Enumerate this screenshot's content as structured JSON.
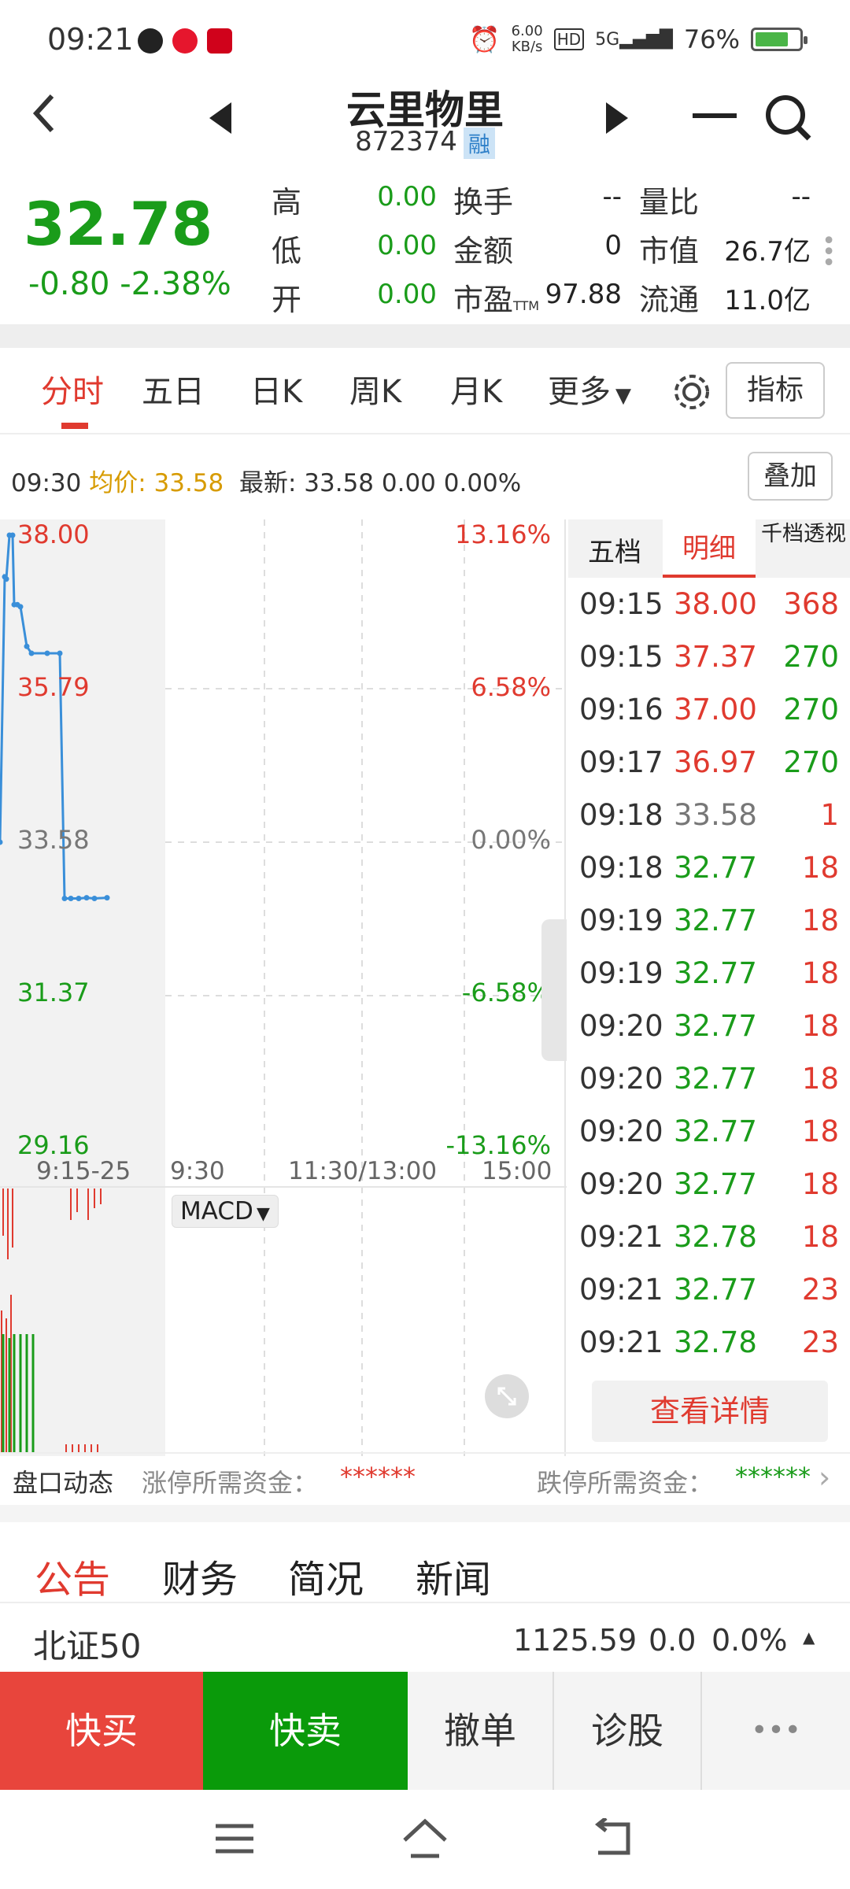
{
  "status_bar": {
    "time": "09:21",
    "net_speed_top": "6.00",
    "net_speed_bottom": "KB/s",
    "network": "5G",
    "battery": "76%",
    "battery_level": 0.76
  },
  "header": {
    "title": "云里物里",
    "code": "872374",
    "badge": "融"
  },
  "quote": {
    "price": "32.78",
    "change": "-0.80  -2.38%",
    "high_label": "高",
    "high_value": "0.00",
    "low_label": "低",
    "low_value": "0.00",
    "open_label": "开",
    "open_value": "0.00",
    "turnover_label": "换手",
    "turnover_value": "--",
    "amount_label": "金额",
    "amount_value": "0",
    "pe_label": "市盈",
    "pe_sub": "TTM",
    "pe_value": "97.88",
    "vol_ratio_label": "量比",
    "vol_ratio_value": "--",
    "mktcap_label": "市值",
    "mktcap_value": "26.7亿",
    "float_label": "流通",
    "float_value": "11.0亿"
  },
  "tabs": {
    "items": [
      "分时",
      "五日",
      "日K",
      "周K",
      "月K",
      "更多"
    ],
    "active": "分时",
    "indicator_button": "指标"
  },
  "info_line": {
    "time": "09:30",
    "avg_label": "均价:",
    "avg_value": "33.58",
    "latest": "最新: 33.58 0.00 0.00%",
    "overlay_button": "叠加"
  },
  "chart_data": {
    "type": "line",
    "y_left_ticks": [
      "38.00",
      "35.79",
      "33.58",
      "31.37",
      "29.16"
    ],
    "y_right_ticks": [
      "13.16%",
      "6.58%",
      "0.00%",
      "-6.58%",
      "-13.16%"
    ],
    "x_ticks": [
      "9:15-25",
      "9:30",
      "11:30/13:00",
      "15:00"
    ],
    "ylim": [
      29.16,
      38.0
    ],
    "series": [
      {
        "values": [
          33.58,
          37.4,
          37.37,
          38.0,
          38.0,
          37.0,
          37.0,
          36.97,
          36.4,
          36.3,
          36.3,
          36.3,
          32.77,
          32.77,
          32.77,
          32.78,
          32.77,
          32.78
        ]
      }
    ],
    "indicator_dropdown": "MACD"
  },
  "detail_panel": {
    "tabs": [
      "五档",
      "明细",
      "千档透视"
    ],
    "active_tab": "明细",
    "trades": [
      {
        "time": "09:15",
        "price": "38.00",
        "vol": "368",
        "price_color": "red",
        "vol_color": "red"
      },
      {
        "time": "09:15",
        "price": "37.37",
        "vol": "270",
        "price_color": "red",
        "vol_color": "green"
      },
      {
        "time": "09:16",
        "price": "37.00",
        "vol": "270",
        "price_color": "red",
        "vol_color": "green"
      },
      {
        "time": "09:17",
        "price": "36.97",
        "vol": "270",
        "price_color": "red",
        "vol_color": "green"
      },
      {
        "time": "09:18",
        "price": "33.58",
        "vol": "1",
        "price_color": "gray",
        "vol_color": "red"
      },
      {
        "time": "09:18",
        "price": "32.77",
        "vol": "18",
        "price_color": "green",
        "vol_color": "red"
      },
      {
        "time": "09:19",
        "price": "32.77",
        "vol": "18",
        "price_color": "green",
        "vol_color": "red"
      },
      {
        "time": "09:19",
        "price": "32.77",
        "vol": "18",
        "price_color": "green",
        "vol_color": "red"
      },
      {
        "time": "09:20",
        "price": "32.77",
        "vol": "18",
        "price_color": "green",
        "vol_color": "red"
      },
      {
        "time": "09:20",
        "price": "32.77",
        "vol": "18",
        "price_color": "green",
        "vol_color": "red"
      },
      {
        "time": "09:20",
        "price": "32.77",
        "vol": "18",
        "price_color": "green",
        "vol_color": "red"
      },
      {
        "time": "09:20",
        "price": "32.77",
        "vol": "18",
        "price_color": "green",
        "vol_color": "red"
      },
      {
        "time": "09:21",
        "price": "32.78",
        "vol": "18",
        "price_color": "green",
        "vol_color": "red"
      },
      {
        "time": "09:21",
        "price": "32.77",
        "vol": "23",
        "price_color": "green",
        "vol_color": "red"
      },
      {
        "time": "09:21",
        "price": "32.78",
        "vol": "23",
        "price_color": "green",
        "vol_color": "red"
      }
    ],
    "view_details_button": "查看详情"
  },
  "dynamics": {
    "label": "盘口动态",
    "limit_up_label": "涨停所需资金：",
    "limit_up_value": "******",
    "limit_down_label": "跌停所需资金：",
    "limit_down_value": "******"
  },
  "news_tabs": [
    "公告",
    "财务",
    "简况",
    "新闻"
  ],
  "index_bar": {
    "name": "北证50",
    "value": "1125.59",
    "change": "0.0",
    "pct": "0.0%"
  },
  "actions": {
    "buy": "快买",
    "sell": "快卖",
    "cancel": "撤单",
    "diagnose": "诊股",
    "more": "•••"
  },
  "colors": {
    "up_red": "#e03a2f",
    "down_green": "#1a9c1a",
    "line_blue": "#3a8fd9",
    "avg_yellow": "#d79b00"
  }
}
